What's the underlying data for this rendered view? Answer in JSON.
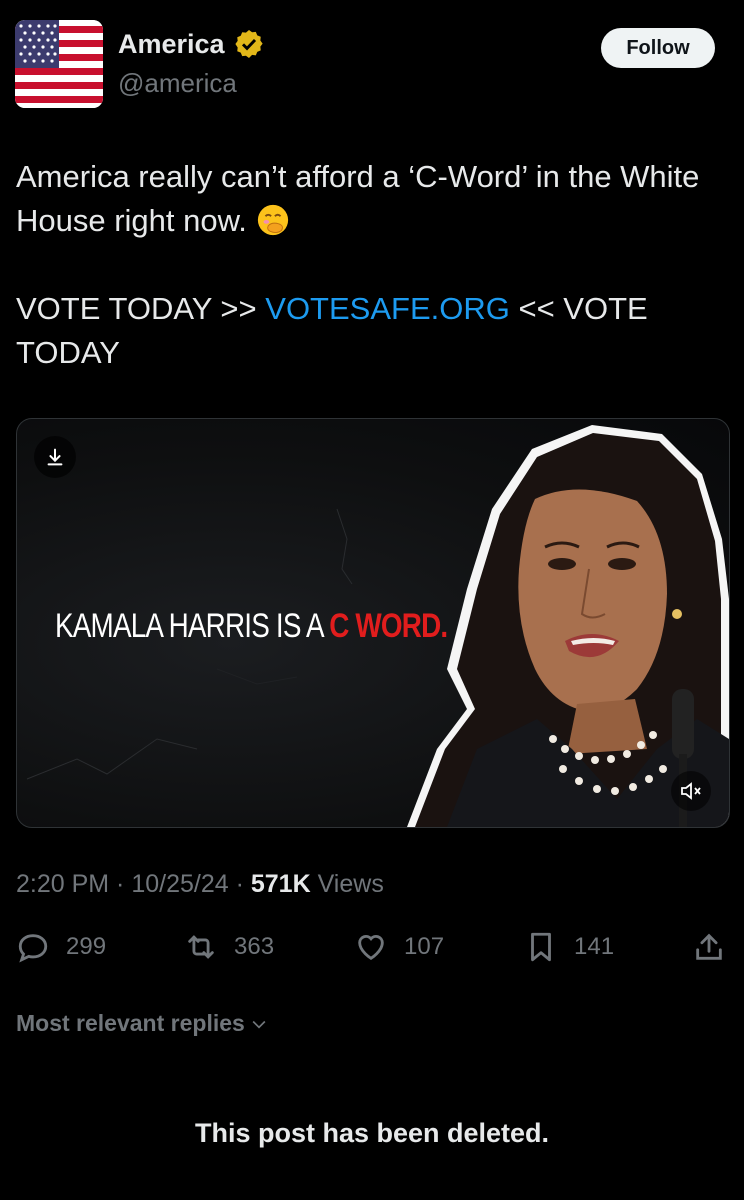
{
  "author": {
    "display_name": "America",
    "handle": "@america",
    "verified": true,
    "avatar_icon": "us-flag-icon"
  },
  "follow_label": "Follow",
  "post": {
    "line1": "America really can’t afford a ‘C-Word’ in the White House right now. ",
    "emoji": "face-with-hand-over-mouth-emoji",
    "vote_prefix": "VOTE TODAY >> ",
    "link_text": "VOTESAFE.ORG",
    "vote_suffix": " << VOTE TODAY"
  },
  "media": {
    "caption_main": "KAMALA HARRIS IS A ",
    "caption_red": "C WORD."
  },
  "meta": {
    "time": "2:20 PM",
    "sep1": " · ",
    "date": "10/25/24",
    "sep2": " · ",
    "views_count": "571K",
    "views_label": " Views"
  },
  "actions": {
    "replies": "299",
    "reposts": "363",
    "likes": "107",
    "bookmarks": "141"
  },
  "replies_sort_label": "Most relevant replies",
  "deleted_notice": "This post has been deleted.",
  "colors": {
    "link": "#1d9bf0",
    "secondary_text": "#71767b",
    "accent_red": "#e11d1d"
  }
}
